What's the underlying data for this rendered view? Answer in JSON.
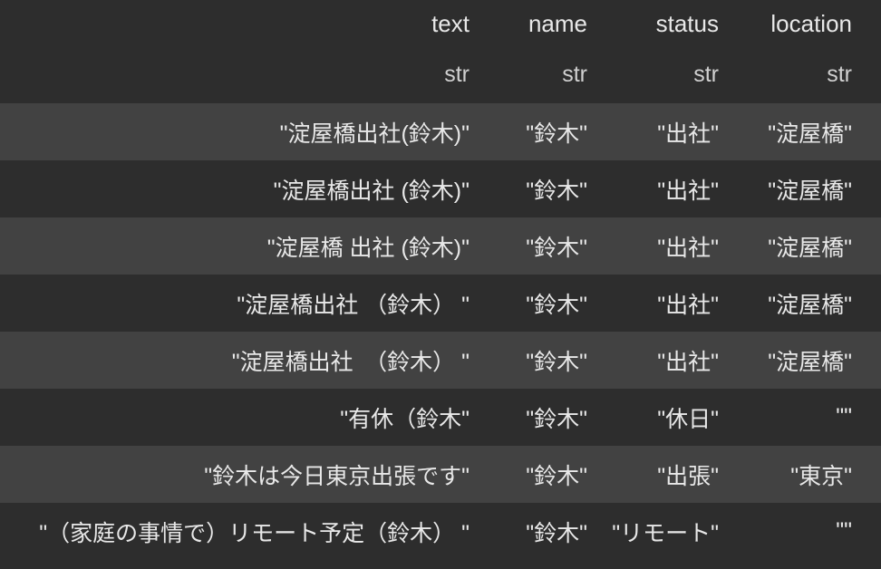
{
  "columns": [
    {
      "name": "text",
      "type": "str"
    },
    {
      "name": "name",
      "type": "str"
    },
    {
      "name": "status",
      "type": "str"
    },
    {
      "name": "location",
      "type": "str"
    }
  ],
  "rows": [
    {
      "text": "\"淀屋橋出社(鈴木)\"",
      "name": "\"鈴木\"",
      "status": "\"出社\"",
      "location": "\"淀屋橋\""
    },
    {
      "text": "\"淀屋橋出社 (鈴木)\"",
      "name": "\"鈴木\"",
      "status": "\"出社\"",
      "location": "\"淀屋橋\""
    },
    {
      "text": "\"淀屋橋 出社 (鈴木)\"",
      "name": "\"鈴木\"",
      "status": "\"出社\"",
      "location": "\"淀屋橋\""
    },
    {
      "text": "\"淀屋橋出社 （鈴木） \"",
      "name": "\"鈴木\"",
      "status": "\"出社\"",
      "location": "\"淀屋橋\""
    },
    {
      "text": "\"淀屋橋出社　（鈴木） \"",
      "name": "\"鈴木\"",
      "status": "\"出社\"",
      "location": "\"淀屋橋\""
    },
    {
      "text": "\"有休（鈴木\"",
      "name": "\"鈴木\"",
      "status": "\"休日\"",
      "location": "\"\""
    },
    {
      "text": "\"鈴木は今日東京出張です\"",
      "name": "\"鈴木\"",
      "status": "\"出張\"",
      "location": "\"東京\""
    },
    {
      "text": "\"（家庭の事情で）リモート予定（鈴木） \"",
      "name": "\"鈴木\"",
      "status": "\"リモート\"",
      "location": "\"\""
    }
  ]
}
